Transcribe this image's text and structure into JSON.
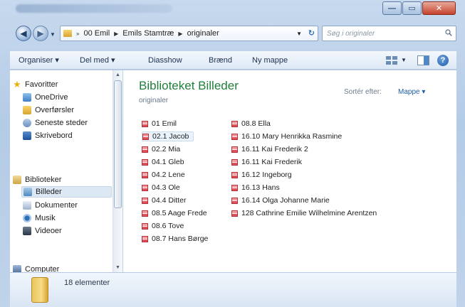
{
  "window": {
    "controls": {
      "minimize": "—",
      "maximize": "▭",
      "close": "✕"
    }
  },
  "address": {
    "crumbs": [
      "00 Emil",
      "Emils Stamtræ",
      "originaler"
    ],
    "search_placeholder": "Søg i originaler"
  },
  "toolbar": {
    "organiser": "Organiser ▾",
    "del_med": "Del med ▾",
    "diasshow": "Diasshow",
    "braend": "Brænd",
    "ny_mappe": "Ny mappe"
  },
  "nav": {
    "favorites": "Favoritter",
    "onedrive": "OneDrive",
    "overfoersler": "Overførsler",
    "seneste": "Seneste steder",
    "skrivebord": "Skrivebord",
    "biblioteker": "Biblioteker",
    "billeder": "Billeder",
    "dokumenter": "Dokumenter",
    "musik": "Musik",
    "videoer": "Videoer",
    "computer": "Computer"
  },
  "content": {
    "title": "Biblioteket Billeder",
    "subtitle": "originaler",
    "sort_label": "Sortér efter:",
    "sort_value": "Mappe ▾",
    "files_col1": [
      "01 Emil",
      "02.1 Jacob",
      "02.2 Mia",
      "04.1 Gleb",
      "04.2 Lene",
      "04.3 Ole",
      "04.4 Ditter",
      "08.5 Aage Frede",
      "08.6 Tove",
      "08.7 Hans Børge"
    ],
    "files_col2": [
      "08.8 Ella",
      "16.10 Mary Henrikka Rasmine",
      "16.11 Kai Frederik 2",
      "16.11 Kai Frederik",
      "16.12 Ingeborg",
      "16.13 Hans",
      "16.14 Olga Johanne Marie",
      "128 Cathrine Emilie Wilhelmine Arentzen"
    ]
  },
  "details": {
    "count": "18 elementer"
  },
  "colors": {
    "title_green": "#1f7f3a",
    "link_blue": "#1f5ea8",
    "selection": "#dde8f5"
  }
}
